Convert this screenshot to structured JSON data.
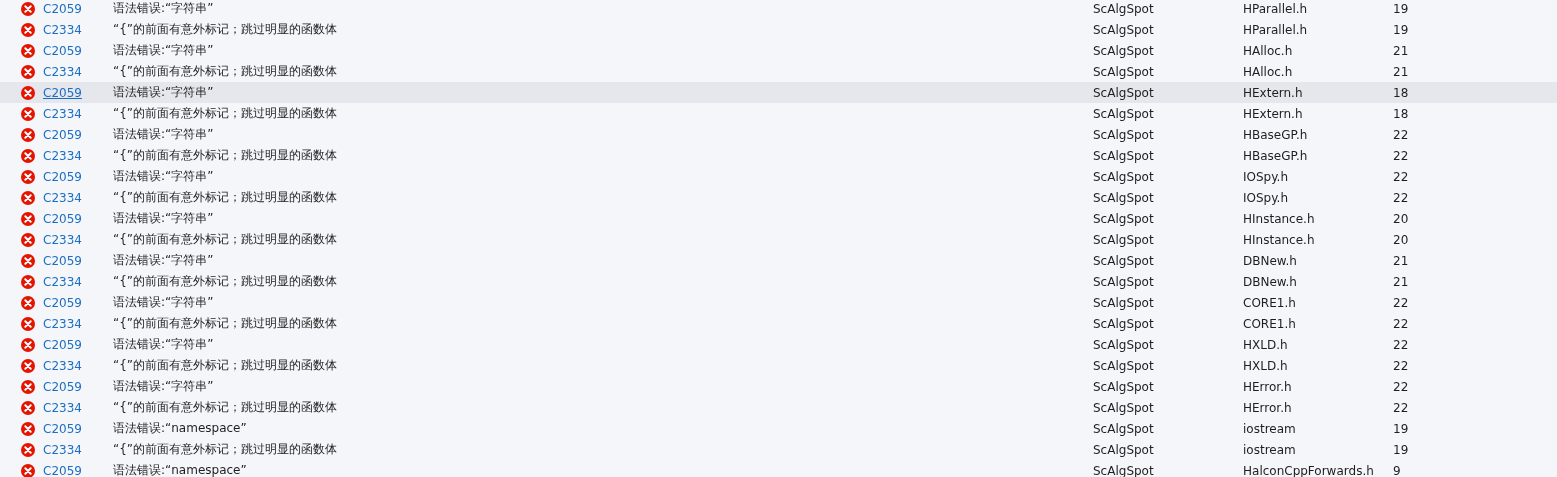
{
  "error_list": {
    "rows": [
      {
        "code": "C2059",
        "description": "语法错误:“字符串”",
        "project": "ScAlgSpot",
        "file": "HParallel.h",
        "line": "19",
        "selected": false
      },
      {
        "code": "C2334",
        "description": "“{”的前面有意外标记；跳过明显的函数体",
        "project": "ScAlgSpot",
        "file": "HParallel.h",
        "line": "19",
        "selected": false
      },
      {
        "code": "C2059",
        "description": "语法错误:“字符串”",
        "project": "ScAlgSpot",
        "file": "HAlloc.h",
        "line": "21",
        "selected": false
      },
      {
        "code": "C2334",
        "description": "“{”的前面有意外标记；跳过明显的函数体",
        "project": "ScAlgSpot",
        "file": "HAlloc.h",
        "line": "21",
        "selected": false
      },
      {
        "code": "C2059",
        "description": "语法错误:“字符串”",
        "project": "ScAlgSpot",
        "file": "HExtern.h",
        "line": "18",
        "selected": true
      },
      {
        "code": "C2334",
        "description": "“{”的前面有意外标记；跳过明显的函数体",
        "project": "ScAlgSpot",
        "file": "HExtern.h",
        "line": "18",
        "selected": false
      },
      {
        "code": "C2059",
        "description": "语法错误:“字符串”",
        "project": "ScAlgSpot",
        "file": "HBaseGP.h",
        "line": "22",
        "selected": false
      },
      {
        "code": "C2334",
        "description": "“{”的前面有意外标记；跳过明显的函数体",
        "project": "ScAlgSpot",
        "file": "HBaseGP.h",
        "line": "22",
        "selected": false
      },
      {
        "code": "C2059",
        "description": "语法错误:“字符串”",
        "project": "ScAlgSpot",
        "file": "IOSpy.h",
        "line": "22",
        "selected": false
      },
      {
        "code": "C2334",
        "description": "“{”的前面有意外标记；跳过明显的函数体",
        "project": "ScAlgSpot",
        "file": "IOSpy.h",
        "line": "22",
        "selected": false
      },
      {
        "code": "C2059",
        "description": "语法错误:“字符串”",
        "project": "ScAlgSpot",
        "file": "HInstance.h",
        "line": "20",
        "selected": false
      },
      {
        "code": "C2334",
        "description": "“{”的前面有意外标记；跳过明显的函数体",
        "project": "ScAlgSpot",
        "file": "HInstance.h",
        "line": "20",
        "selected": false
      },
      {
        "code": "C2059",
        "description": "语法错误:“字符串”",
        "project": "ScAlgSpot",
        "file": "DBNew.h",
        "line": "21",
        "selected": false
      },
      {
        "code": "C2334",
        "description": "“{”的前面有意外标记；跳过明显的函数体",
        "project": "ScAlgSpot",
        "file": "DBNew.h",
        "line": "21",
        "selected": false
      },
      {
        "code": "C2059",
        "description": "语法错误:“字符串”",
        "project": "ScAlgSpot",
        "file": "CORE1.h",
        "line": "22",
        "selected": false
      },
      {
        "code": "C2334",
        "description": "“{”的前面有意外标记；跳过明显的函数体",
        "project": "ScAlgSpot",
        "file": "CORE1.h",
        "line": "22",
        "selected": false
      },
      {
        "code": "C2059",
        "description": "语法错误:“字符串”",
        "project": "ScAlgSpot",
        "file": "HXLD.h",
        "line": "22",
        "selected": false
      },
      {
        "code": "C2334",
        "description": "“{”的前面有意外标记；跳过明显的函数体",
        "project": "ScAlgSpot",
        "file": "HXLD.h",
        "line": "22",
        "selected": false
      },
      {
        "code": "C2059",
        "description": "语法错误:“字符串”",
        "project": "ScAlgSpot",
        "file": "HError.h",
        "line": "22",
        "selected": false
      },
      {
        "code": "C2334",
        "description": "“{”的前面有意外标记；跳过明显的函数体",
        "project": "ScAlgSpot",
        "file": "HError.h",
        "line": "22",
        "selected": false
      },
      {
        "code": "C2059",
        "description": "语法错误:“namespace”",
        "project": "ScAlgSpot",
        "file": "iostream",
        "line": "19",
        "selected": false
      },
      {
        "code": "C2334",
        "description": "“{”的前面有意外标记；跳过明显的函数体",
        "project": "ScAlgSpot",
        "file": "iostream",
        "line": "19",
        "selected": false
      },
      {
        "code": "C2059",
        "description": "语法错误:“namespace”",
        "project": "ScAlgSpot",
        "file": "HalconCppForwards.h",
        "line": "9",
        "selected": false
      }
    ]
  }
}
